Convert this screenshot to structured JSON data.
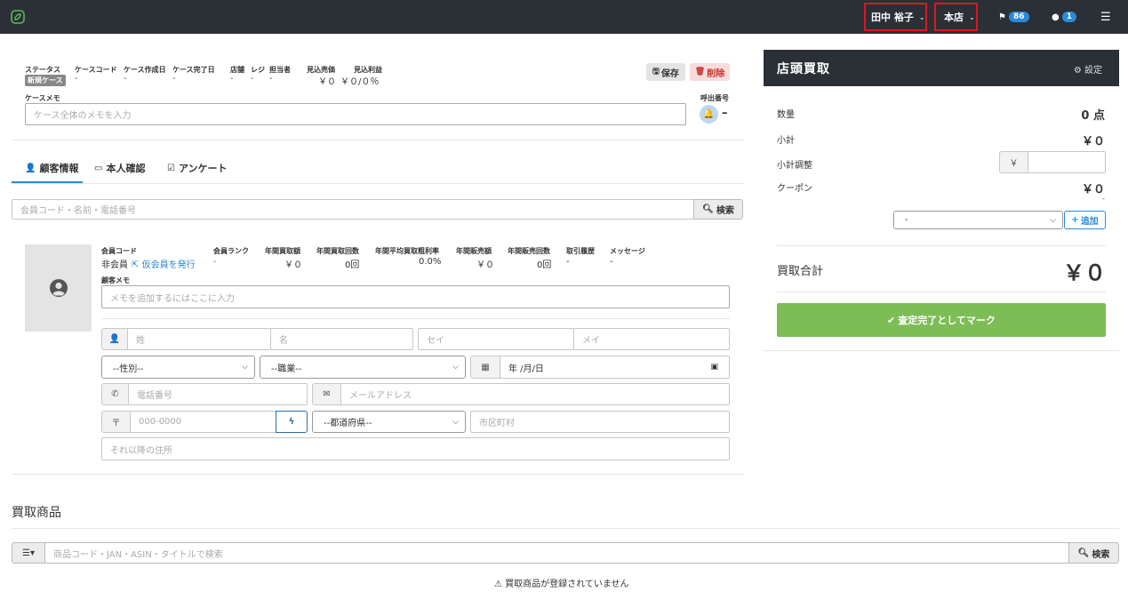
{
  "navbar": {
    "user_name": "田中 裕子",
    "store": "本店",
    "flag_count": "86",
    "message_count": "1",
    "brand_color": "#2b2f36",
    "highlight_color": "#e0161f"
  },
  "case": {
    "status_label": "ステータス",
    "status_badge": "新規ケース",
    "case_code_label": "ケースコード",
    "case_code": "-",
    "created_label": "ケース作成日",
    "created": "-",
    "completed_label": "ケース完了日",
    "completed": "-",
    "store_label": "店舗",
    "store": "-",
    "register_label": "レジ",
    "register": "-",
    "staff_label": "担当者",
    "staff": "-",
    "expected_sales_label": "見込売価",
    "expected_sales": "￥０",
    "expected_profit_label": "見込利益",
    "expected_profit": "￥０/０％",
    "save_label": "保存",
    "delete_label": "削除",
    "memo_label": "ケースメモ",
    "memo_placeholder": "ケース全体のメモを入力",
    "call_number_label": "呼出番号",
    "call_number": "–"
  },
  "tabs": [
    {
      "label": "顧客情報",
      "icon": "user-icon"
    },
    {
      "label": "本人確認",
      "icon": "id-card-icon"
    },
    {
      "label": "アンケート",
      "icon": "check-square-icon"
    }
  ],
  "customer_search": {
    "placeholder": "会員コード・名前・電話番号",
    "button": "検索"
  },
  "member": {
    "code_label": "会員コード",
    "status": "非会員",
    "issue_link": "仮会員を発行",
    "rank_label": "会員ランク",
    "rank": "-",
    "annual_purchase_label": "年間買取額",
    "annual_purchase": "￥０",
    "annual_purchase_count_label": "年間買取回数",
    "annual_purchase_count": "0回",
    "avg_margin_label": "年間平均買取粗利率",
    "avg_margin": "0.0%",
    "annual_sales_label": "年間販売額",
    "annual_sales": "￥０",
    "annual_sales_count_label": "年間販売回数",
    "annual_sales_count": "0回",
    "history_label": "取引履歴",
    "history": "-",
    "message_label": "メッセージ",
    "message": "-",
    "memo_label": "顧客メモ",
    "memo_placeholder": "メモを追加するにはここに入力"
  },
  "form": {
    "last_name": "姓",
    "first_name": "名",
    "last_kana": "セイ",
    "first_kana": "メイ",
    "gender": "--性別--",
    "occupation": "--職業--",
    "birthday": "年 /月/日",
    "phone": "電話番号",
    "email": "メールアドレス",
    "postal_symbol": "〒",
    "postal": "000-0000",
    "prefecture": "--都道府県--",
    "city": "市区町村",
    "address": "それ以降の住所"
  },
  "products": {
    "title": "買取商品",
    "search_placeholder": "商品コード・JAN・ASIN・タイトルで検索",
    "search_button": "検索",
    "empty_message": "買取商品が登録されていません"
  },
  "panel": {
    "title": "店頭買取",
    "settings": "設定",
    "quantity_label": "数量",
    "quantity": "0 点",
    "subtotal_label": "小計",
    "subtotal": "￥０",
    "adjust_label": "小計調整",
    "yen": "￥",
    "coupon_label": "クーポン",
    "coupon": "￥０",
    "coupon_sub": "-",
    "coupon_select": "-",
    "add_button": "追加",
    "total_label": "買取合計",
    "total": "￥０",
    "complete_button": "査定完了としてマーク",
    "complete_color": "#7dbd55"
  }
}
